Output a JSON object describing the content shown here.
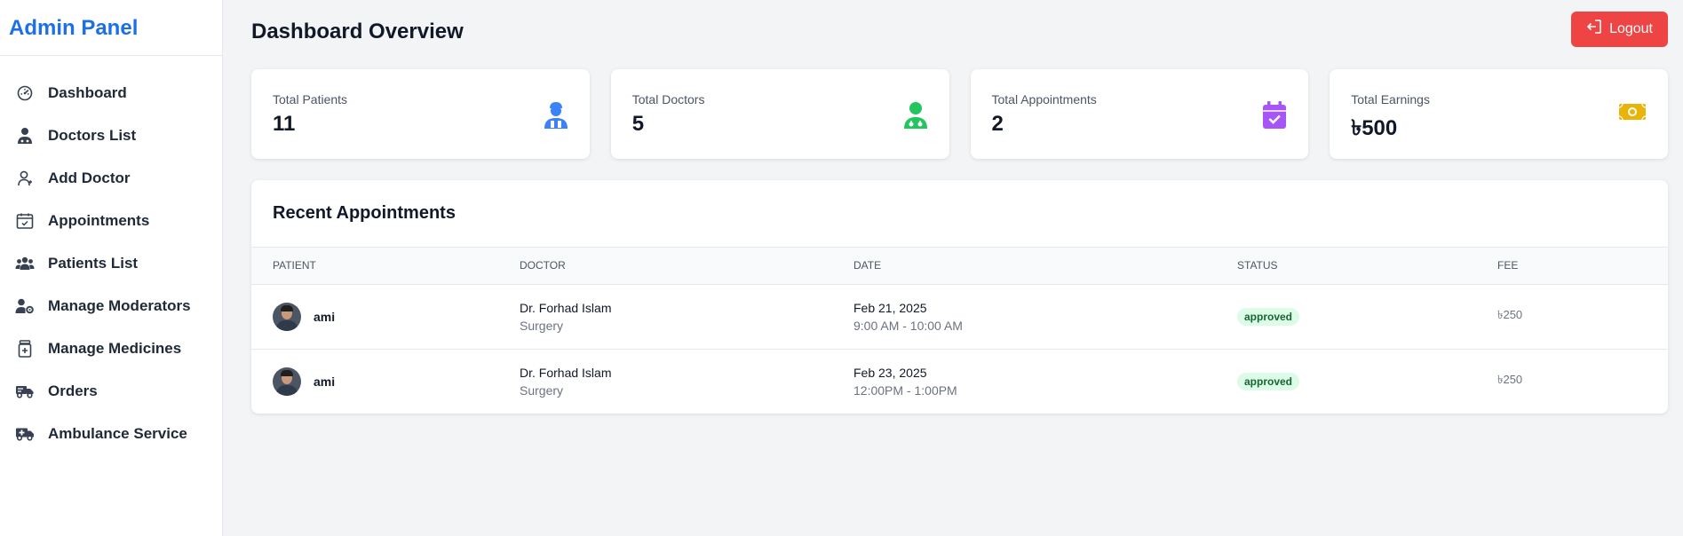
{
  "sidebar": {
    "brand": "Admin Panel",
    "items": [
      {
        "label": "Dashboard",
        "icon": "gauge-icon"
      },
      {
        "label": "Doctors List",
        "icon": "doctor-icon"
      },
      {
        "label": "Add Doctor",
        "icon": "user-add-icon"
      },
      {
        "label": "Appointments",
        "icon": "calendar-check-icon"
      },
      {
        "label": "Patients List",
        "icon": "users-icon"
      },
      {
        "label": "Manage Moderators",
        "icon": "user-gear-icon"
      },
      {
        "label": "Manage Medicines",
        "icon": "medicine-icon"
      },
      {
        "label": "Orders",
        "icon": "truck-icon"
      },
      {
        "label": "Ambulance Service",
        "icon": "ambulance-icon"
      }
    ]
  },
  "header": {
    "title": "Dashboard Overview",
    "logout_label": "Logout"
  },
  "stats": [
    {
      "label": "Total Patients",
      "value": "11",
      "icon": "patient-icon",
      "color": "#3b82f6"
    },
    {
      "label": "Total Doctors",
      "value": "5",
      "icon": "doctor-icon",
      "color": "#22c55e"
    },
    {
      "label": "Total Appointments",
      "value": "2",
      "icon": "calendar-check-icon",
      "color": "#a855f7"
    },
    {
      "label": "Total Earnings",
      "value": "৳500",
      "icon": "money-icon",
      "color": "#eab308"
    }
  ],
  "appointments": {
    "title": "Recent Appointments",
    "columns": [
      "Patient",
      "Doctor",
      "Date",
      "Status",
      "Fee"
    ],
    "rows": [
      {
        "patient": "ami",
        "doctor": "Dr. Forhad Islam",
        "specialty": "Surgery",
        "date": "Feb 21, 2025",
        "time": "9:00 AM - 10:00 AM",
        "status": "approved",
        "fee": "৳250"
      },
      {
        "patient": "ami",
        "doctor": "Dr. Forhad Islam",
        "specialty": "Surgery",
        "date": "Feb 23, 2025",
        "time": "12:00PM - 1:00PM",
        "status": "approved",
        "fee": "৳250"
      }
    ]
  }
}
